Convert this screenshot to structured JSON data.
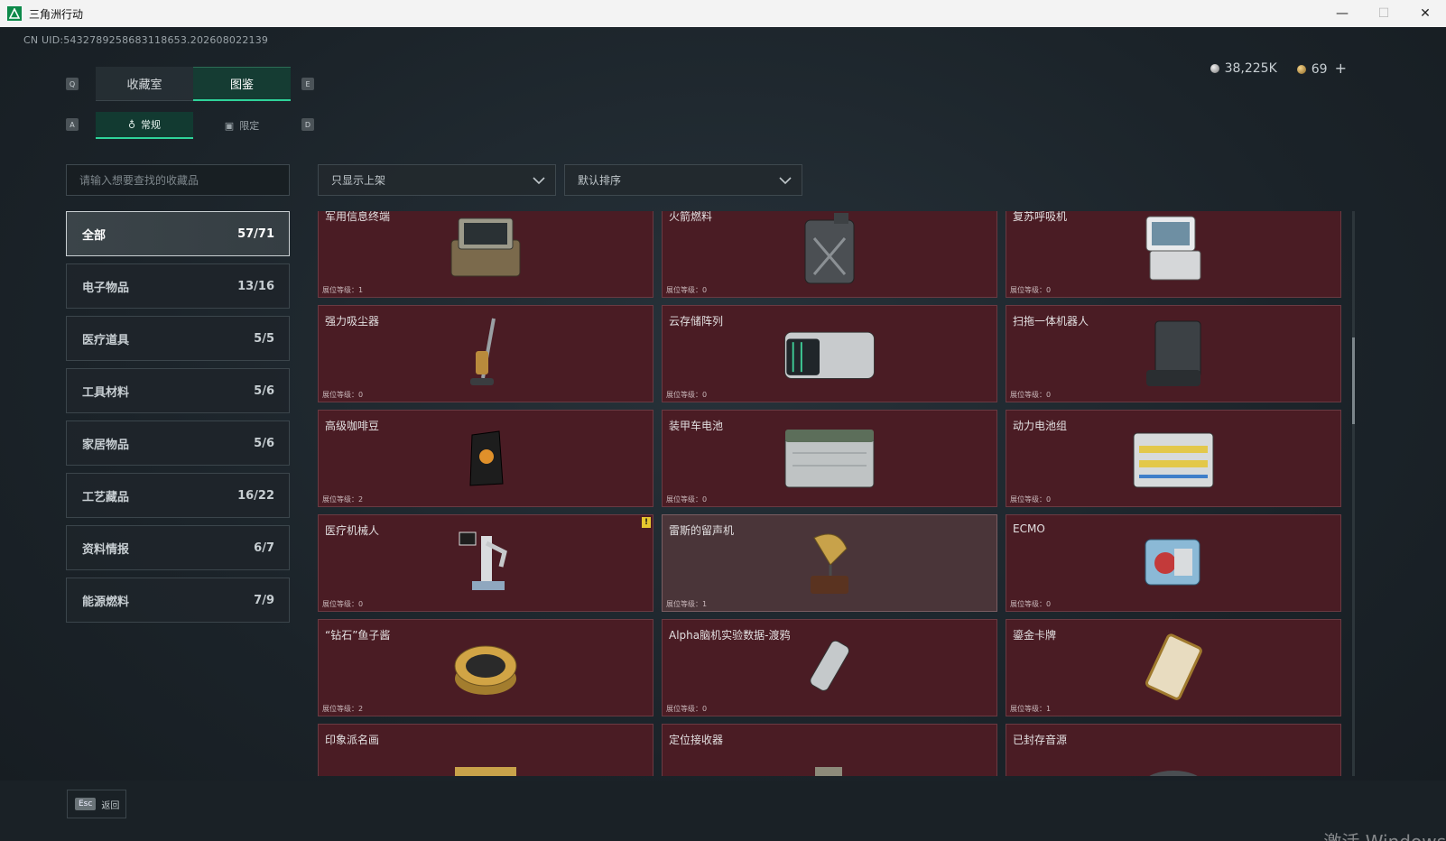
{
  "window": {
    "title": "三角洲行动",
    "min_glyph": "—",
    "max_glyph": "☐",
    "close_glyph": "✕"
  },
  "uid": "CN UID:5432789258683118653.202608022139",
  "currency": {
    "silver": "38,225K",
    "gold": "69",
    "add_glyph": "+"
  },
  "key_hints": {
    "q": "Q",
    "e": "E",
    "a": "A",
    "d": "D"
  },
  "tabs": {
    "collection_room": "收藏室",
    "catalog": "图鉴"
  },
  "subtabs": {
    "regular": "常规",
    "limited": "限定"
  },
  "search": {
    "placeholder": "请输入想要查找的收藏品"
  },
  "filters": {
    "shelf": "只显示上架",
    "sort": "默认排序"
  },
  "categories": [
    {
      "label": "全部",
      "count": "57/71"
    },
    {
      "label": "电子物品",
      "count": "13/16"
    },
    {
      "label": "医疗道具",
      "count": "5/5"
    },
    {
      "label": "工具材料",
      "count": "5/6"
    },
    {
      "label": "家居物品",
      "count": "5/6"
    },
    {
      "label": "工艺藏品",
      "count": "16/22"
    },
    {
      "label": "资料情报",
      "count": "6/7"
    },
    {
      "label": "能源燃料",
      "count": "7/9"
    }
  ],
  "items": [
    {
      "name": "军用信息终端",
      "level": "展位等级：1"
    },
    {
      "name": "火箭燃料",
      "level": "展位等级：0"
    },
    {
      "name": "复苏呼吸机",
      "level": "展位等级：0"
    },
    {
      "name": "强力吸尘器",
      "level": "展位等级：0"
    },
    {
      "name": "云存储阵列",
      "level": "展位等级：0"
    },
    {
      "name": "扫拖一体机器人",
      "level": "展位等级：0"
    },
    {
      "name": "高级咖啡豆",
      "level": "展位等级：2"
    },
    {
      "name": "装甲车电池",
      "level": "展位等级：0"
    },
    {
      "name": "动力电池组",
      "level": "展位等级：0"
    },
    {
      "name": "医疗机械人",
      "level": "展位等级：0",
      "warn": "!"
    },
    {
      "name": "雷斯的留声机",
      "level": "展位等级：1"
    },
    {
      "name": "ECMO",
      "level": "展位等级：0"
    },
    {
      "name": "“钻石”鱼子酱",
      "level": "展位等级：2"
    },
    {
      "name": "Alpha脑机实验数据-渡鸦",
      "level": "展位等级：0"
    },
    {
      "name": "鎏金卡牌",
      "level": "展位等级：1"
    },
    {
      "name": "印象派名画",
      "level": ""
    },
    {
      "name": "定位接收器",
      "level": ""
    },
    {
      "name": "已封存音源",
      "level": ""
    }
  ],
  "bottom": {
    "esc_key": "Esc",
    "back_label": "返回"
  },
  "watermark": "激活 Windows",
  "colors": {
    "accent": "#2fd39a",
    "card_bg": "#4a1c24",
    "card_highlight": "#4a3539"
  }
}
